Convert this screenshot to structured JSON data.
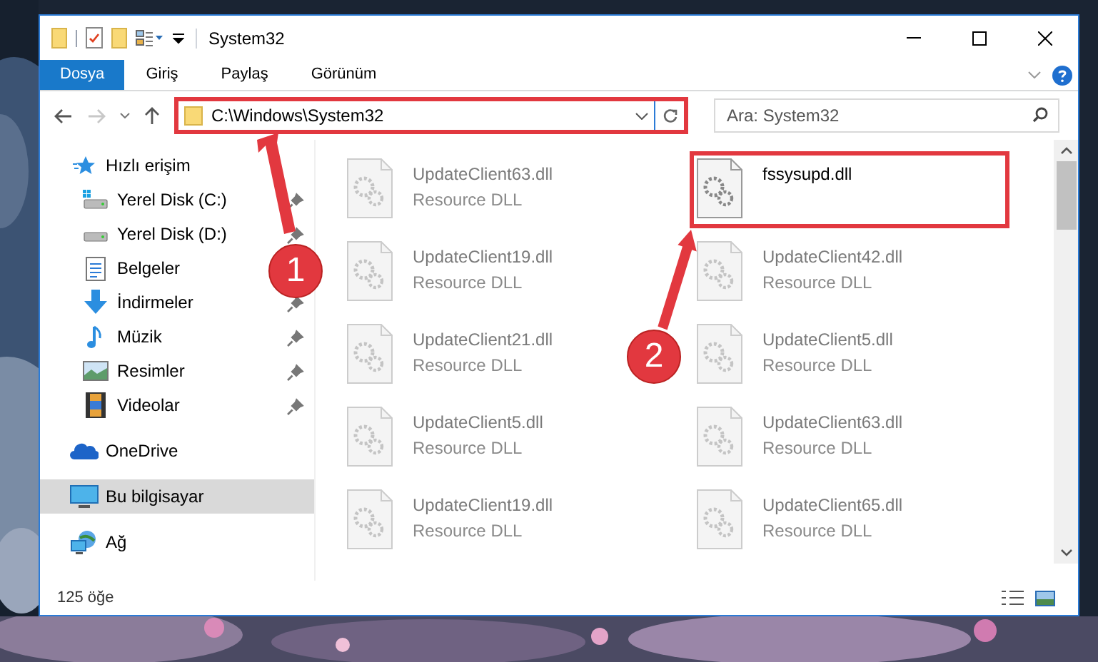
{
  "window": {
    "title": "System32"
  },
  "ribbon_tabs": [
    {
      "label": "Dosya",
      "selected": true
    },
    {
      "label": "Giriş",
      "selected": false
    },
    {
      "label": "Paylaş",
      "selected": false
    },
    {
      "label": "Görünüm",
      "selected": false
    }
  ],
  "address": {
    "path": "C:\\Windows\\System32",
    "highlighted": true
  },
  "search": {
    "placeholder": "Ara: System32"
  },
  "nav_items": [
    {
      "label": "Hızlı erişim",
      "kind": "star",
      "selected": false,
      "children": [
        {
          "label": "Yerel Disk (C:)",
          "kind": "drive-win",
          "pinned": true,
          "selected": false
        },
        {
          "label": "Yerel Disk (D:)",
          "kind": "drive",
          "pinned": true,
          "selected": false
        },
        {
          "label": "Belgeler",
          "kind": "docs",
          "selected": false
        },
        {
          "label": "İndirmeler",
          "kind": "download",
          "pinned": true,
          "selected": false
        },
        {
          "label": "Müzik",
          "kind": "music",
          "pinned": true,
          "selected": false
        },
        {
          "label": "Resimler",
          "kind": "pictures",
          "pinned": true,
          "selected": false
        },
        {
          "label": "Videolar",
          "kind": "videos",
          "pinned": true,
          "selected": false
        }
      ]
    },
    {
      "label": "OneDrive",
      "kind": "cloud",
      "selected": false
    },
    {
      "label": "Bu bilgisayar",
      "kind": "pc",
      "selected": true
    },
    {
      "label": "Ağ",
      "kind": "network",
      "selected": false
    }
  ],
  "files": [
    {
      "name": "UpdateClient63.dll",
      "type": "Resource DLL",
      "blurred": true,
      "highlighted": false
    },
    {
      "name": "fssysupd.dll",
      "blurred": false,
      "highlighted": true
    },
    {
      "name": "UpdateClient19.dll",
      "type": "Resource DLL",
      "blurred": true,
      "highlighted": false
    },
    {
      "name": "UpdateClient42.dll",
      "type": "Resource DLL",
      "blurred": true,
      "highlighted": false
    },
    {
      "name": "UpdateClient21.dll",
      "type": "Resource DLL",
      "blurred": true,
      "highlighted": false
    },
    {
      "name": "UpdateClient5.dll",
      "type": "Resource DLL",
      "blurred": true,
      "highlighted": false
    },
    {
      "name": "UpdateClient5.dll",
      "type": "Resource DLL",
      "blurred": true,
      "highlighted": false
    },
    {
      "name": "UpdateClient63.dll",
      "type": "Resource DLL",
      "blurred": true,
      "highlighted": false
    },
    {
      "name": "UpdateClient19.dll",
      "type": "Resource DLL",
      "blurred": true,
      "highlighted": false
    },
    {
      "name": "UpdateClient65.dll",
      "type": "Resource DLL",
      "blurred": true,
      "highlighted": false
    }
  ],
  "status_bar": {
    "item_count": "125 öğe"
  },
  "annotations": [
    {
      "number": "1"
    },
    {
      "number": "2"
    }
  ]
}
